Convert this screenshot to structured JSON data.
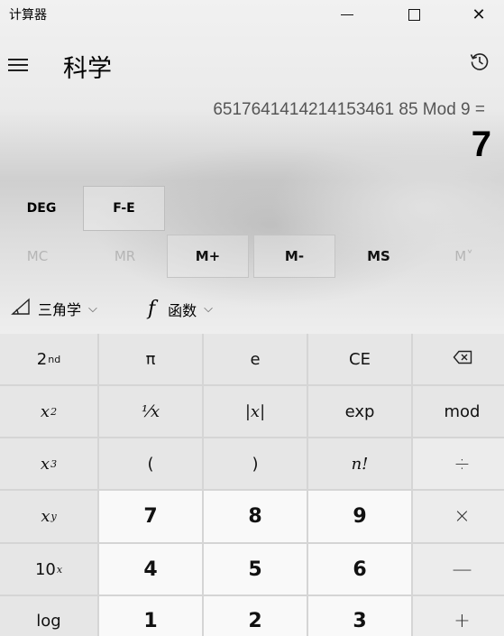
{
  "window": {
    "title": "计算器"
  },
  "header": {
    "mode": "科学"
  },
  "display": {
    "expression": "6517641414214153461 85 Mod 9 =",
    "result": "7"
  },
  "angle": {
    "deg_label": "DEG",
    "fe_label": "F-E"
  },
  "memory": {
    "mc": "MC",
    "mr": "MR",
    "mplus": "M+",
    "mminus": "M-",
    "ms": "MS",
    "mlist": "M˅"
  },
  "functions": {
    "trig_label": "三角学",
    "func_label": "函数",
    "func_symbol": "f"
  },
  "keys": {
    "second": "2",
    "second_sup": "nd",
    "pi": "π",
    "e": "e",
    "ce": "CE",
    "x2": "x",
    "x2_sup": "2",
    "reciprocal": "⅟x",
    "abs": "|x|",
    "exp": "exp",
    "mod": "mod",
    "x3": "x",
    "x3_sup": "3",
    "lparen": "(",
    "rparen": ")",
    "factorial": "n!",
    "divide": "÷",
    "xy": "x",
    "xy_sup": "y",
    "seven": "7",
    "eight": "8",
    "nine": "9",
    "multiply": "×",
    "ten_x": "10",
    "ten_x_sup": "x",
    "four": "4",
    "five": "5",
    "six": "6",
    "minus": "—",
    "log": "log",
    "one": "1",
    "two": "2",
    "three": "3",
    "plus": "+"
  },
  "icons": {
    "hamburger": "hamburger-menu-icon",
    "history": "history-icon",
    "trig": "triangle-ruler-icon",
    "backspace": "backspace-icon"
  }
}
